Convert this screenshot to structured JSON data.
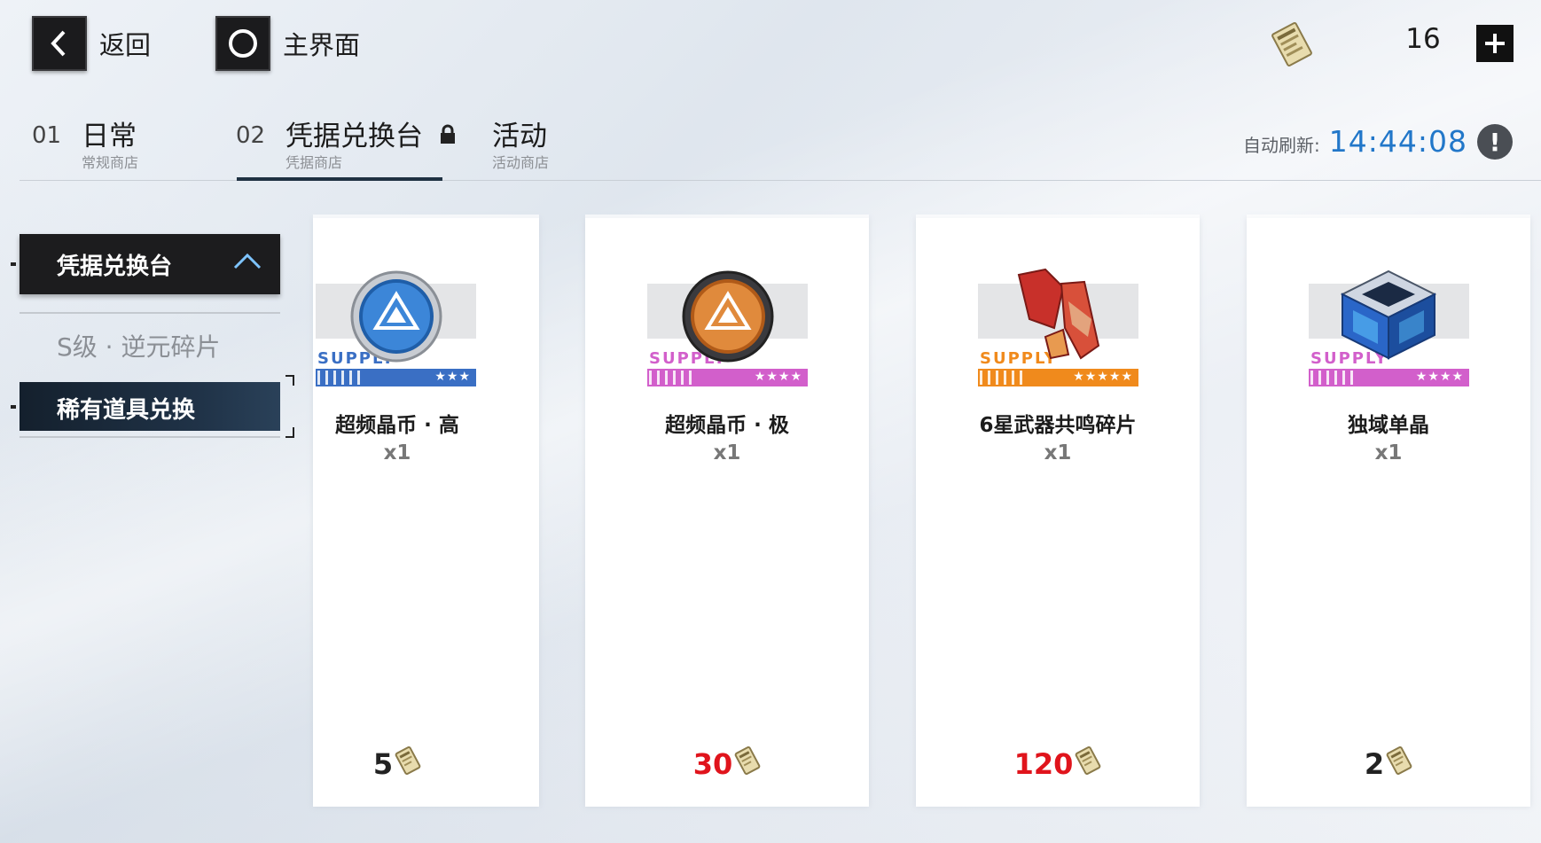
{
  "nav": {
    "back_label": "返回",
    "home_label": "主界面"
  },
  "currency": {
    "icon": "voucher-ticket-icon",
    "value": "16"
  },
  "tabs": [
    {
      "num": "01",
      "title": "日常",
      "sub": "常规商店",
      "locked": false
    },
    {
      "num": "02",
      "title": "凭据兑换台",
      "sub": "凭据商店",
      "locked": false,
      "active": true
    },
    {
      "title": "活动",
      "sub": "活动商店",
      "locked": true
    }
  ],
  "refresh": {
    "label": "自动刷新:",
    "time": "14:44:08"
  },
  "sidebar": {
    "header": "凭据兑换台",
    "items": [
      {
        "label": "S级 · 逆元碎片",
        "active": false
      },
      {
        "label": "稀有道具兑换",
        "active": true
      }
    ]
  },
  "items": [
    {
      "name": "超频晶币 · 高",
      "qty": "x1",
      "price": "5",
      "price_color": "#222222",
      "rarity_color": "#3a6fc4",
      "stars": "★★★",
      "supply": "SUPPLY",
      "icon": "blue-overclock-coin-icon"
    },
    {
      "name": "超频晶币 · 极",
      "qty": "x1",
      "price": "30",
      "price_color": "#e0141c",
      "rarity_color": "#d25fcb",
      "stars": "★★★★",
      "supply": "SUPPLY",
      "icon": "gold-overclock-coin-icon"
    },
    {
      "name": "6星武器共鸣碎片",
      "qty": "x1",
      "price": "120",
      "price_color": "#e0141c",
      "rarity_color": "#f08a1c",
      "stars": "★★★★★",
      "supply": "SUPPLY",
      "icon": "red-weapon-shard-icon"
    },
    {
      "name": "独域单晶",
      "qty": "x1",
      "price": "2",
      "price_color": "#222222",
      "rarity_color": "#d25fcb",
      "stars": "★★★★",
      "supply": "SUPPLY",
      "icon": "domain-crystal-cube-icon"
    }
  ]
}
